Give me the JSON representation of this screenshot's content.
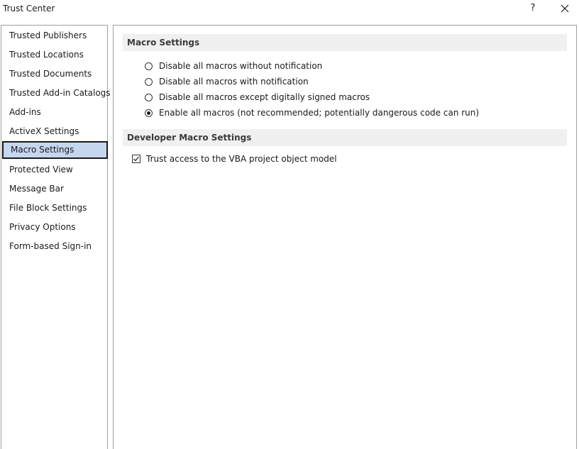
{
  "window": {
    "title": "Trust Center",
    "help_label": "?"
  },
  "sidebar": {
    "items": [
      {
        "label": "Trusted Publishers",
        "selected": false
      },
      {
        "label": "Trusted Locations",
        "selected": false
      },
      {
        "label": "Trusted Documents",
        "selected": false
      },
      {
        "label": "Trusted Add-in Catalogs",
        "selected": false
      },
      {
        "label": "Add-ins",
        "selected": false
      },
      {
        "label": "ActiveX Settings",
        "selected": false
      },
      {
        "label": "Macro Settings",
        "selected": true
      },
      {
        "label": "Protected View",
        "selected": false
      },
      {
        "label": "Message Bar",
        "selected": false
      },
      {
        "label": "File Block Settings",
        "selected": false
      },
      {
        "label": "Privacy Options",
        "selected": false
      },
      {
        "label": "Form-based Sign-in",
        "selected": false
      }
    ]
  },
  "macro_settings": {
    "header": "Macro Settings",
    "options": [
      {
        "label": "Disable all macros without notification",
        "checked": false
      },
      {
        "label": "Disable all macros with notification",
        "checked": false
      },
      {
        "label": "Disable all macros except digitally signed macros",
        "checked": false
      },
      {
        "label": "Enable all macros (not recommended; potentially dangerous code can run)",
        "checked": true
      }
    ]
  },
  "developer_settings": {
    "header": "Developer Macro Settings",
    "trust_vba_label": "Trust access to the VBA project object model",
    "trust_vba_checked": true
  },
  "colors": {
    "selected_bg": "#c5d6ef",
    "section_bg": "#f0f0f0",
    "border": "#a0a0a0"
  }
}
